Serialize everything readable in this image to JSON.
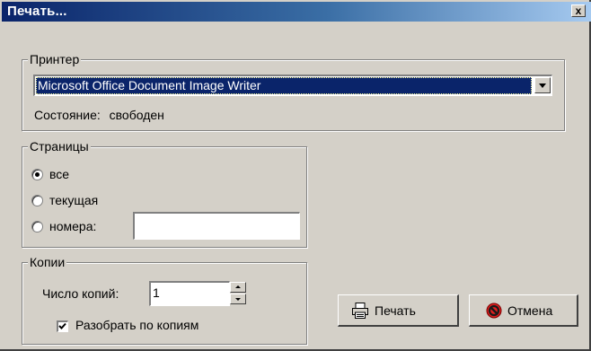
{
  "window": {
    "title": "Печать...",
    "close_label": "x"
  },
  "printer": {
    "group_label": "Принтер",
    "selected": "Microsoft Office Document Image Writer",
    "status_label": "Состояние:",
    "status_value": "свободен"
  },
  "pages": {
    "group_label": "Страницы",
    "options": [
      {
        "label": "все",
        "checked": true
      },
      {
        "label": "текущая",
        "checked": false
      },
      {
        "label": "номера:",
        "checked": false
      }
    ],
    "numbers_value": ""
  },
  "copies": {
    "group_label": "Копии",
    "count_label": "Число копий:",
    "count_value": "1",
    "collate_label": "Разобрать по копиям",
    "collate_checked": true
  },
  "buttons": {
    "print_label": "Печать",
    "cancel_label": "Отмена"
  },
  "icons": {
    "print": "printer-icon",
    "cancel": "cancel-icon"
  },
  "colors": {
    "titlebar_start": "#0a246a",
    "selection": "#0a246a",
    "cancel_icon": "#e02020"
  }
}
